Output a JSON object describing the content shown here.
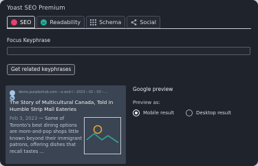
{
  "header": {
    "title": "Yoast SEO Premium"
  },
  "tabs": [
    {
      "label": "SEO",
      "icon": "seo-status-dot-icon",
      "color": "#e8416b",
      "active": true
    },
    {
      "label": "Readability",
      "icon": "readability-smiley-icon",
      "color": "#21b39a",
      "active": false
    },
    {
      "label": "Schema",
      "icon": "schema-grid-icon",
      "active": false
    },
    {
      "label": "Social",
      "icon": "share-icon",
      "active": false
    }
  ],
  "focus_keyphrase": {
    "label": "Focus Keyphrase",
    "value": "",
    "placeholder": ""
  },
  "related_button": {
    "label": "Get related keyphrases"
  },
  "serp": {
    "url": "demo.purpleshub.com › a-and-l › 2023 › 02 › 03 › ...",
    "title": "The Story of Multicultural Canada, Told in Humble Strip Mall Eateries",
    "date": "Feb 3, 2023",
    "separator": " — ",
    "description": "Some of Toronto's best dining options are mom-and-pop shops little known beyond their immigrant patrons, offering dishes that recall tastes ...",
    "favicon_icon": "globe-favicon-icon",
    "thumbnail_icon": "image-placeholder-icon"
  },
  "google_preview": {
    "title": "Google preview",
    "preview_as": "Preview as:",
    "options": [
      {
        "label": "Mobile result",
        "checked": true
      },
      {
        "label": "Desktop result",
        "checked": false
      }
    ]
  },
  "colors": {
    "background": "#1f232b",
    "serp_card": "#3b4452",
    "accent_seo": "#e8416b",
    "accent_readability": "#21b39a",
    "thumbnail_sun": "#e0a73a",
    "thumbnail_mountains": "#2fa493"
  }
}
